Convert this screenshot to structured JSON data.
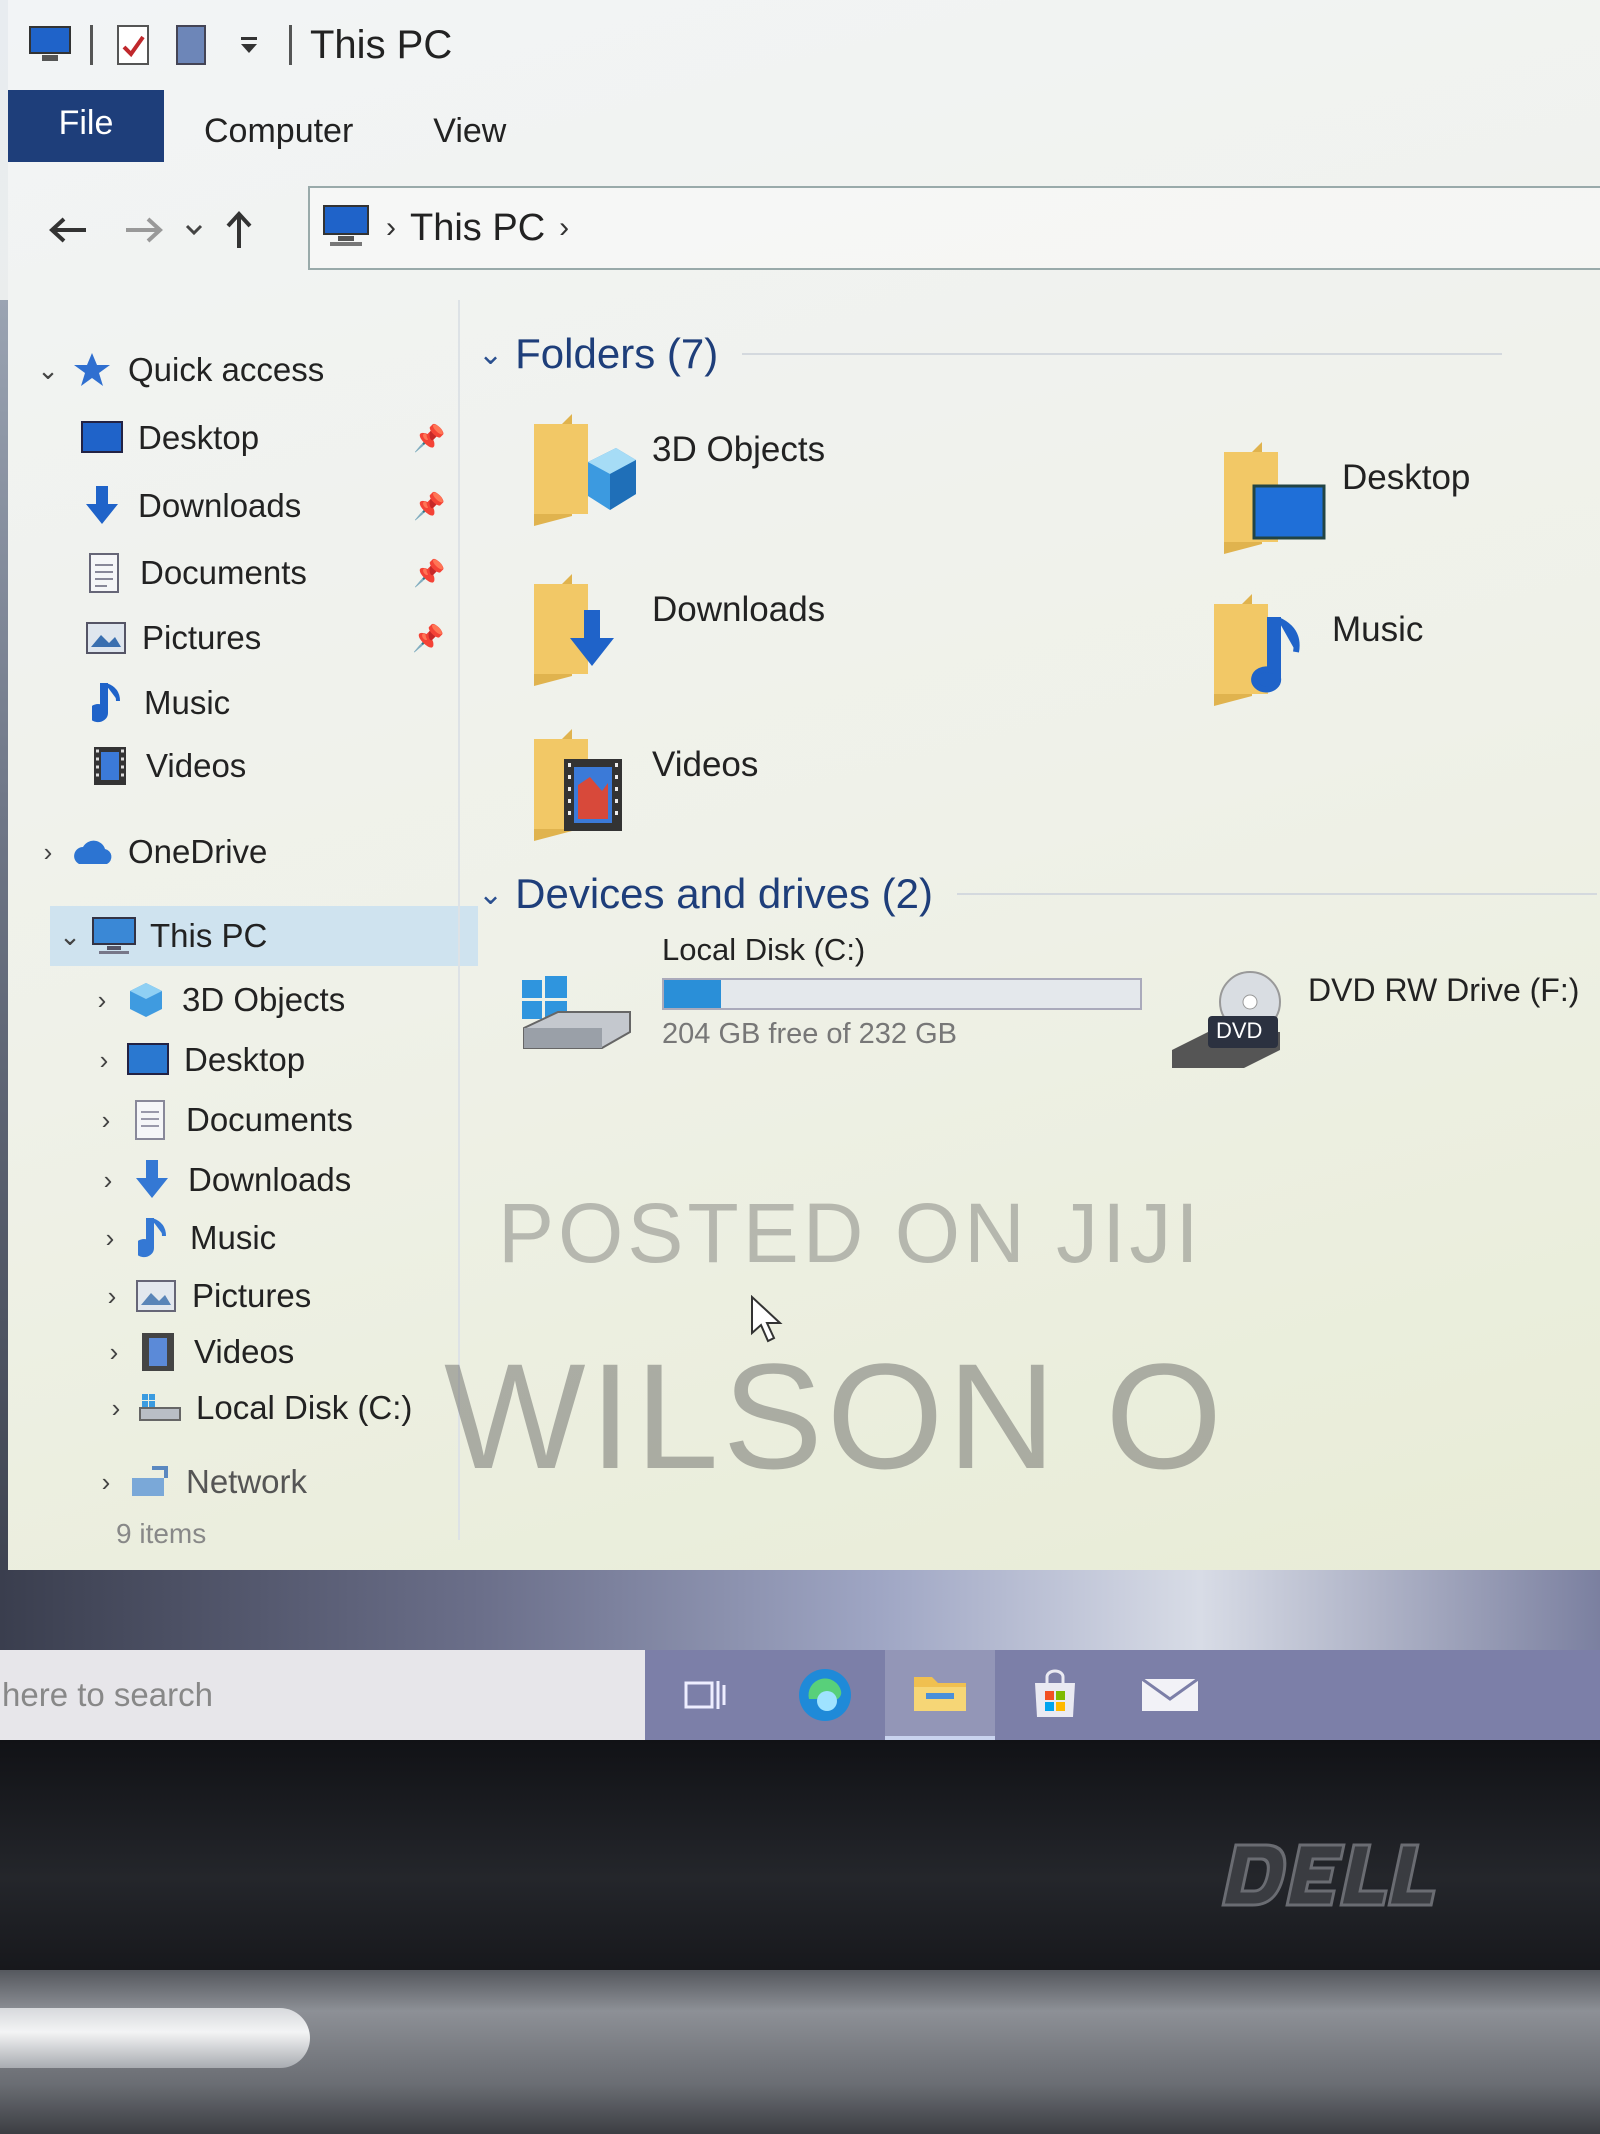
{
  "window": {
    "title": "This PC",
    "tabs": [
      "File",
      "Computer",
      "View"
    ]
  },
  "address": {
    "crumbs": [
      "This PC"
    ]
  },
  "nav": {
    "quick_access": "Quick access",
    "qa_items": [
      {
        "label": "Desktop",
        "icon": "desktop-icon",
        "pinned": true
      },
      {
        "label": "Downloads",
        "icon": "downloads-icon",
        "pinned": true
      },
      {
        "label": "Documents",
        "icon": "documents-icon",
        "pinned": true
      },
      {
        "label": "Pictures",
        "icon": "pictures-icon",
        "pinned": true
      },
      {
        "label": "Music",
        "icon": "music-icon",
        "pinned": false
      },
      {
        "label": "Videos",
        "icon": "videos-icon",
        "pinned": false
      }
    ],
    "onedrive": "OneDrive",
    "this_pc": "This PC",
    "pc_items": [
      {
        "label": "3D Objects",
        "icon": "3d-objects-icon"
      },
      {
        "label": "Desktop",
        "icon": "desktop-icon"
      },
      {
        "label": "Documents",
        "icon": "documents-icon"
      },
      {
        "label": "Downloads",
        "icon": "downloads-icon"
      },
      {
        "label": "Music",
        "icon": "music-icon"
      },
      {
        "label": "Pictures",
        "icon": "pictures-icon"
      },
      {
        "label": "Videos",
        "icon": "videos-icon"
      },
      {
        "label": "Local Disk (C:)",
        "icon": "local-disk-icon"
      }
    ],
    "network": "Network"
  },
  "status": {
    "items": "9 items"
  },
  "content": {
    "folders_heading": "Folders (7)",
    "folders": [
      {
        "label": "3D Objects",
        "icon": "3d-objects-folder-icon"
      },
      {
        "label": "Desktop",
        "icon": "desktop-folder-icon"
      },
      {
        "label": "Downloads",
        "icon": "downloads-folder-icon"
      },
      {
        "label": "Music",
        "icon": "music-folder-icon"
      },
      {
        "label": "Videos",
        "icon": "videos-folder-icon"
      }
    ],
    "devices_heading": "Devices and drives (2)",
    "drives": [
      {
        "label": "Local Disk (C:)",
        "free": "204 GB free of 232 GB",
        "used_fraction": 0.12
      },
      {
        "label": "DVD RW Drive (F:)",
        "badge": "DVD"
      }
    ]
  },
  "watermark": {
    "line1": "POSTED ON JIJI",
    "line2": "WILSON O"
  },
  "taskbar": {
    "search_placeholder": "here to search",
    "icons": [
      "task-view-icon",
      "edge-icon",
      "file-explorer-icon",
      "store-icon",
      "mail-icon"
    ]
  },
  "colors": {
    "accent": "#1e3e7a",
    "selection": "#cfe3ef",
    "drive_bar": "#2a8fd8",
    "taskbar": "#7c7fa8"
  }
}
